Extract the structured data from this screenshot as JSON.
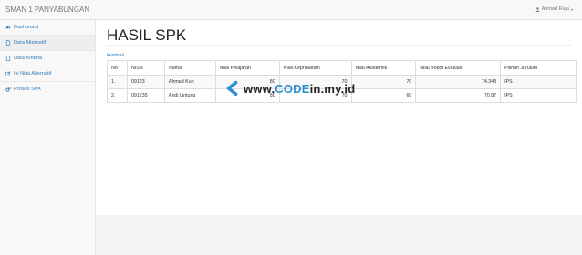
{
  "navbar": {
    "brand": "SMAN 1 PANYABUNGAN",
    "user_name": "Ahmad Raja",
    "user_icon": "user-icon",
    "caret": "▾"
  },
  "sidebar": {
    "items": [
      {
        "label": "Dashboard",
        "icon": "dashboard-icon",
        "active": false
      },
      {
        "label": "Data Alternatif",
        "icon": "file-icon",
        "active": true
      },
      {
        "label": "Data Kriteria",
        "icon": "file-icon",
        "active": false
      },
      {
        "label": "Isi Nilai Alternatif",
        "icon": "edit-icon",
        "active": false
      },
      {
        "label": "Proses SPK",
        "icon": "gears-icon",
        "active": false
      }
    ]
  },
  "main": {
    "title": "HASIL SPK",
    "back_link": "kembali",
    "table": {
      "headers": [
        "No",
        "NISN",
        "Nama",
        "Nilai Pelajaran",
        "Nilai Kepribadian",
        "Nilai Akademik",
        "Nilai Bobot Evaluasi",
        "Pilihan Jurusan"
      ],
      "rows": [
        [
          "1.",
          "09123",
          "Ahmad Kun",
          "80",
          "70",
          "70",
          "74.348",
          "IPS"
        ],
        [
          "2.",
          "091235",
          "Andi Lintung",
          "80",
          "70",
          "60",
          "70.87",
          "IPS"
        ]
      ]
    }
  },
  "watermark": {
    "prefix": "www.",
    "accent": "CODE",
    "suffix": "in.my.id"
  },
  "colors": {
    "link": "#337ab7",
    "watermark_accent": "#2f8fd0"
  }
}
